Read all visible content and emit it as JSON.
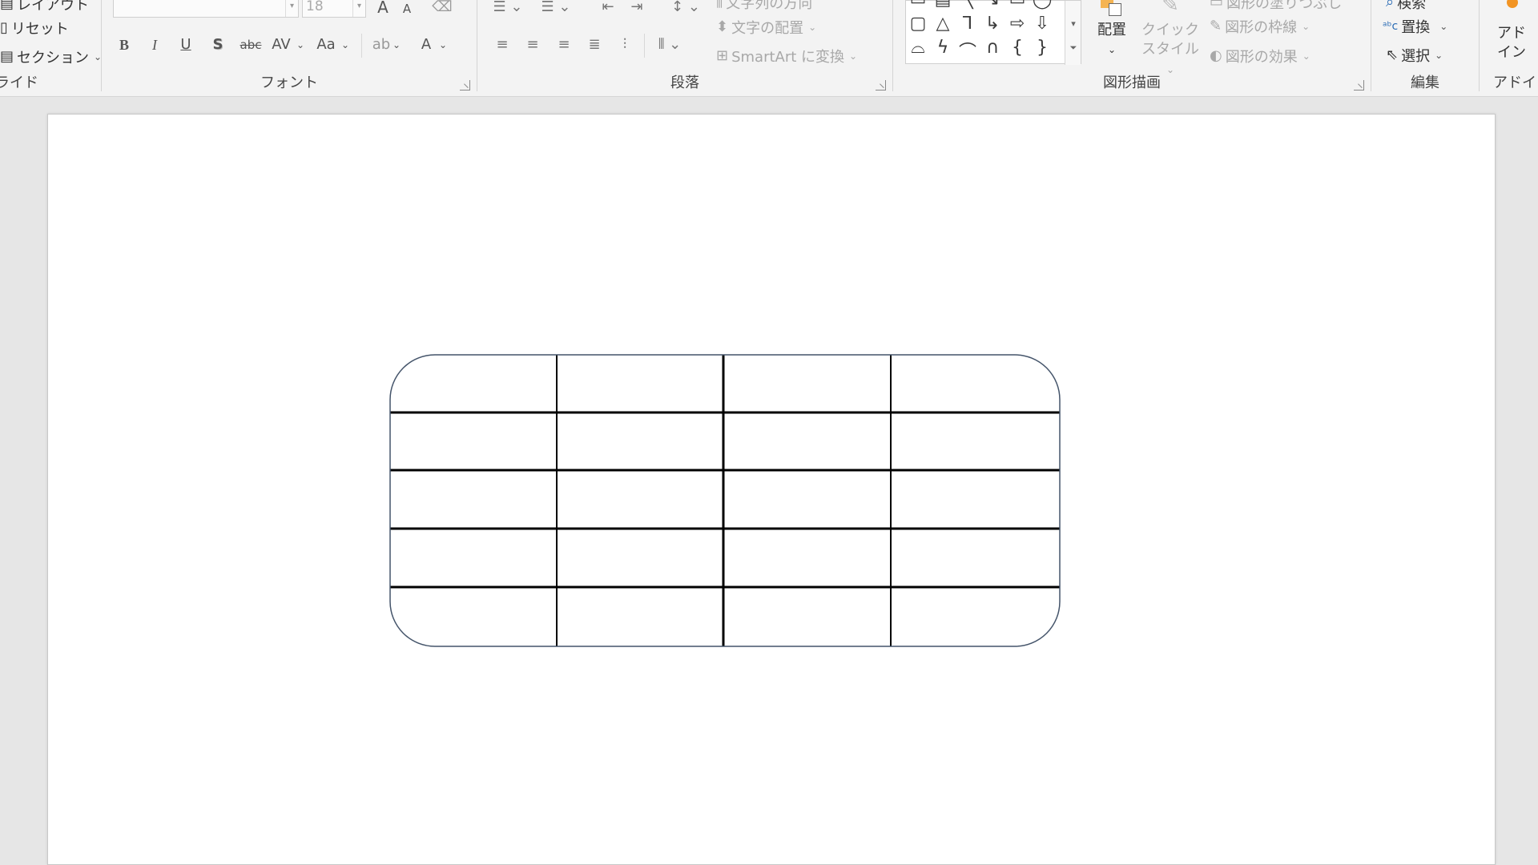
{
  "ribbon": {
    "slides_group": {
      "layout_label": "レイアウト",
      "reset_label": "リセット",
      "section_label": "セクション",
      "group_label": "ライド"
    },
    "font_group": {
      "font_name_value": "",
      "font_size_value": "18",
      "grow_label": "A",
      "shrink_label": "A",
      "bold_label": "B",
      "italic_label": "I",
      "underline_label": "U",
      "shadow_label": "S",
      "strike_label": "abc",
      "spacing_label": "AV",
      "case_label": "Aa",
      "font_color_label": "A",
      "group_label": "フォント"
    },
    "paragraph_group": {
      "text_direction_label": "文字列の方向",
      "align_text_label": "文字の配置",
      "smartart_label": "SmartArt に変換",
      "group_label": "段落"
    },
    "drawing_group": {
      "arrange_label": "配置",
      "quick_style_line1": "クイック",
      "quick_style_line2": "スタイル",
      "shape_fill_label": "図形の塗りつぶし",
      "shape_outline_label": "図形の枠線",
      "shape_effects_label": "図形の効果",
      "group_label": "図形描画"
    },
    "editing_group": {
      "find_label": "検索",
      "replace_label": "置換",
      "select_label": "選択",
      "group_label": "編集"
    },
    "addins_group": {
      "addins_line1": "アド",
      "addins_line2": "イン",
      "group_label": "アドイン"
    }
  },
  "colors": {
    "ribbon_bg": "#f3f3f3",
    "canvas_bg": "#e6e6e6",
    "slide_bg": "#ffffff",
    "table_outline": "#44546a",
    "table_lines": "#000000",
    "addin_accent": "#f29423"
  },
  "slide": {
    "table": {
      "rows": 5,
      "columns": 4,
      "cells": [
        [
          "",
          "",
          "",
          ""
        ],
        [
          "",
          "",
          "",
          ""
        ],
        [
          "",
          "",
          "",
          ""
        ],
        [
          "",
          "",
          "",
          ""
        ],
        [
          "",
          "",
          "",
          ""
        ]
      ]
    }
  }
}
